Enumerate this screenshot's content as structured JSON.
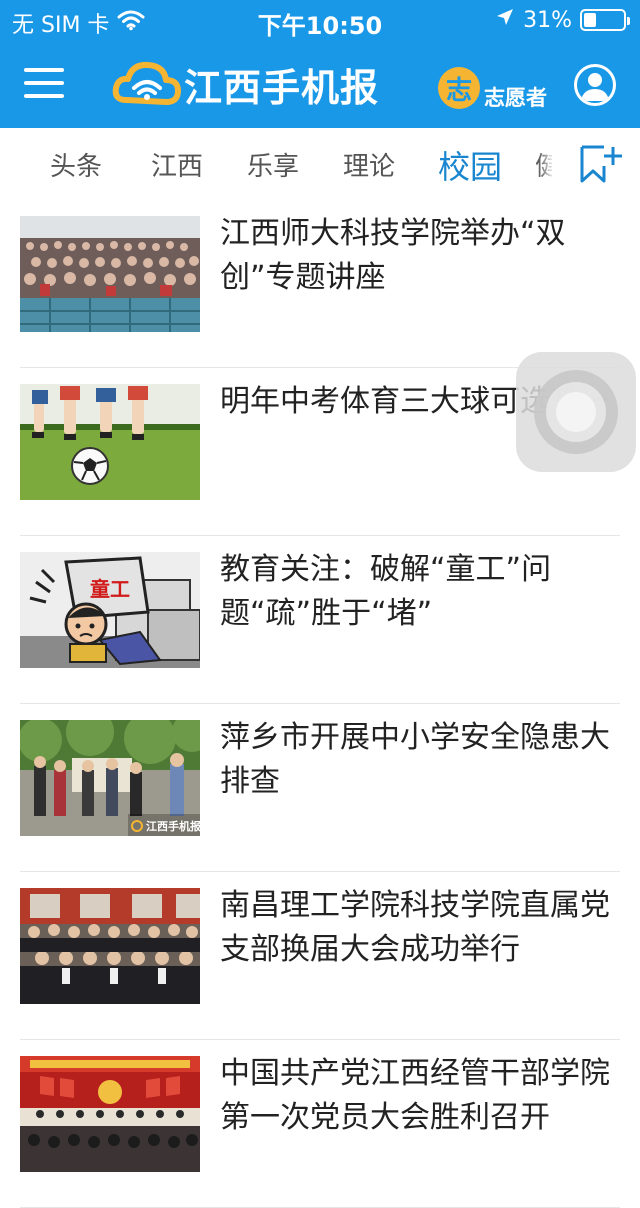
{
  "status_bar": {
    "carrier": "无 SIM 卡",
    "time": "下午10:50",
    "battery_percent": "31%",
    "battery_level": 0.31
  },
  "header": {
    "app_name": "江西手机报",
    "volunteer_badge": "志",
    "volunteer_label": "志愿者"
  },
  "tabs": [
    {
      "label": "头条",
      "active": false
    },
    {
      "label": "江西",
      "active": false
    },
    {
      "label": "乐享",
      "active": false
    },
    {
      "label": "理论",
      "active": false
    },
    {
      "label": "校园",
      "active": true
    },
    {
      "label": "健",
      "active": false
    }
  ],
  "news": [
    {
      "title": "江西师大科技学院举办“双创”专题讲座"
    },
    {
      "title": "明年中考体育三大球可选其一"
    },
    {
      "title": "教育关注：破解“童工”问题“疏”胜于“堵”",
      "thumb_caption": "童工"
    },
    {
      "title": "萍乡市开展中小学安全隐患大排查",
      "thumb_watermark": "江西手机报"
    },
    {
      "title": "南昌理工学院科技学院直属党支部换届大会成功举行"
    },
    {
      "title": "中国共产党江西经管干部学院第一次党员大会胜利召开"
    }
  ],
  "colors": {
    "brand_blue": "#1a98e8",
    "active_tab": "#1a86d0",
    "logo_gold": "#f5b533"
  }
}
